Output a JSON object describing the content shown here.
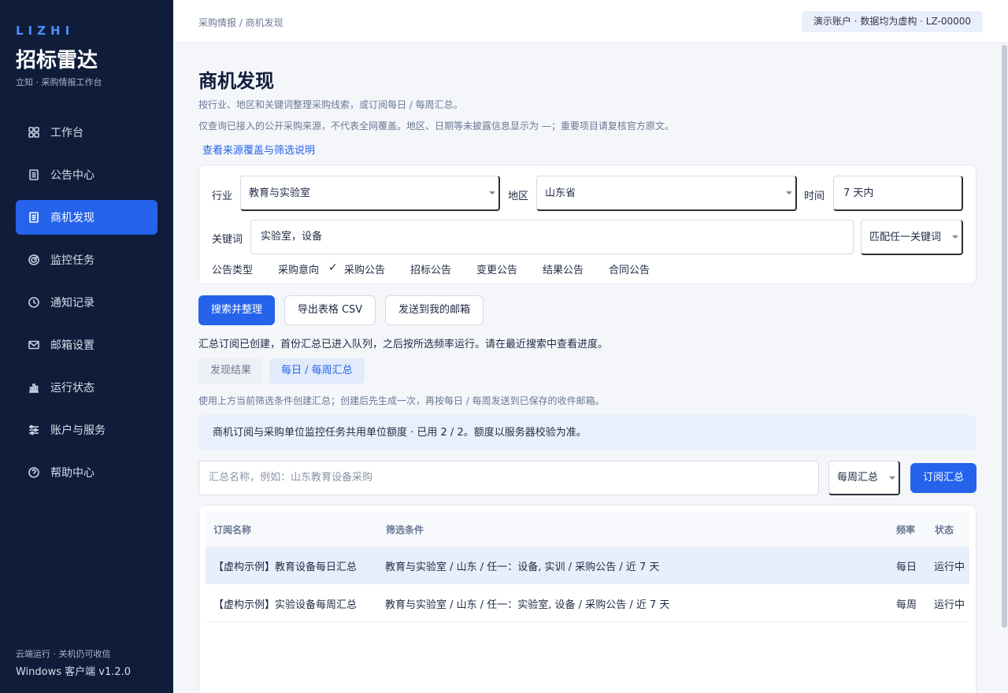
{
  "brand": {
    "en": "LIZHI",
    "title": "招标雷达",
    "subtitle": "立知 · 采购情报工作台"
  },
  "nav": [
    {
      "label": "工作台",
      "icon": "grid-icon"
    },
    {
      "label": "公告中心",
      "icon": "document-icon"
    },
    {
      "label": "商机发现",
      "icon": "document-icon",
      "active": true
    },
    {
      "label": "监控任务",
      "icon": "target-icon"
    },
    {
      "label": "通知记录",
      "icon": "clock-icon"
    },
    {
      "label": "邮箱设置",
      "icon": "mail-icon"
    },
    {
      "label": "运行状态",
      "icon": "bar-chart-icon"
    },
    {
      "label": "账户与服务",
      "icon": "sliders-icon"
    },
    {
      "label": "帮助中心",
      "icon": "help-icon"
    }
  ],
  "sidebar_footer": {
    "line1": "云端运行 · 关机仍可收信",
    "line2": "Windows 客户端  v1.2.0"
  },
  "topbar": {
    "breadcrumb": "采购情报 / 商机发现",
    "account": "演示账户 · 数据均为虚构  ·  LZ-00000"
  },
  "page": {
    "title": "商机发现",
    "desc1": "按行业、地区和关键词整理采购线索，或订阅每日 / 每周汇总。",
    "desc2": "仅查询已接入的公开采购来源，不代表全网覆盖。地区、日期等未披露信息显示为 —；重要项目请复核官方原文。",
    "link": "查看来源覆盖与筛选说明"
  },
  "filters": {
    "industry_label": "行业",
    "industry_value": "教育与实验室",
    "region_label": "地区",
    "region_value": "山东省",
    "time_label": "时间",
    "time_value": "7 天内",
    "keyword_label": "关键词",
    "keyword_value": "实验室，设备",
    "match_value": "匹配任一关键词",
    "type_label": "公告类型",
    "types": [
      "采购意向",
      "采购公告",
      "招标公告",
      "变更公告",
      "结果公告",
      "合同公告"
    ],
    "checked_type": "采购公告",
    "check_mark": "✓"
  },
  "actions": {
    "search": "搜索并整理",
    "export": "导出表格 CSV",
    "email": "发送到我的邮箱"
  },
  "notice": "汇总订阅已创建，首份汇总已进入队列，之后按所选频率运行。请在最近搜索中查看进度。",
  "tabs": {
    "results": "发现结果",
    "digest": "每日 / 每周汇总"
  },
  "hint": "使用上方当前筛选条件创建汇总；创建后先生成一次，再按每日 / 每周发送到已保存的收件邮箱。",
  "quota": "商机订阅与采购单位监控任务共用单位额度 · 已用 2 / 2。额度以服务器校验为准。",
  "subscribe": {
    "placeholder": "汇总名称，例如：山东教育设备采购",
    "frequency": "每周汇总",
    "button": "订阅汇总"
  },
  "table": {
    "headers": [
      "订阅名称",
      "筛选条件",
      "频率",
      "状态"
    ],
    "rows": [
      [
        "【虚构示例】教育设备每日汇总",
        "教育与实验室 / 山东 / 任一：设备, 实训 / 采购公告 / 近 7 天",
        "每日",
        "运行中"
      ],
      [
        "【虚构示例】实验设备每周汇总",
        "教育与实验室 / 山东 / 任一：实验室, 设备 / 采购公告 / 近 7 天",
        "每周",
        "运行中"
      ]
    ]
  }
}
